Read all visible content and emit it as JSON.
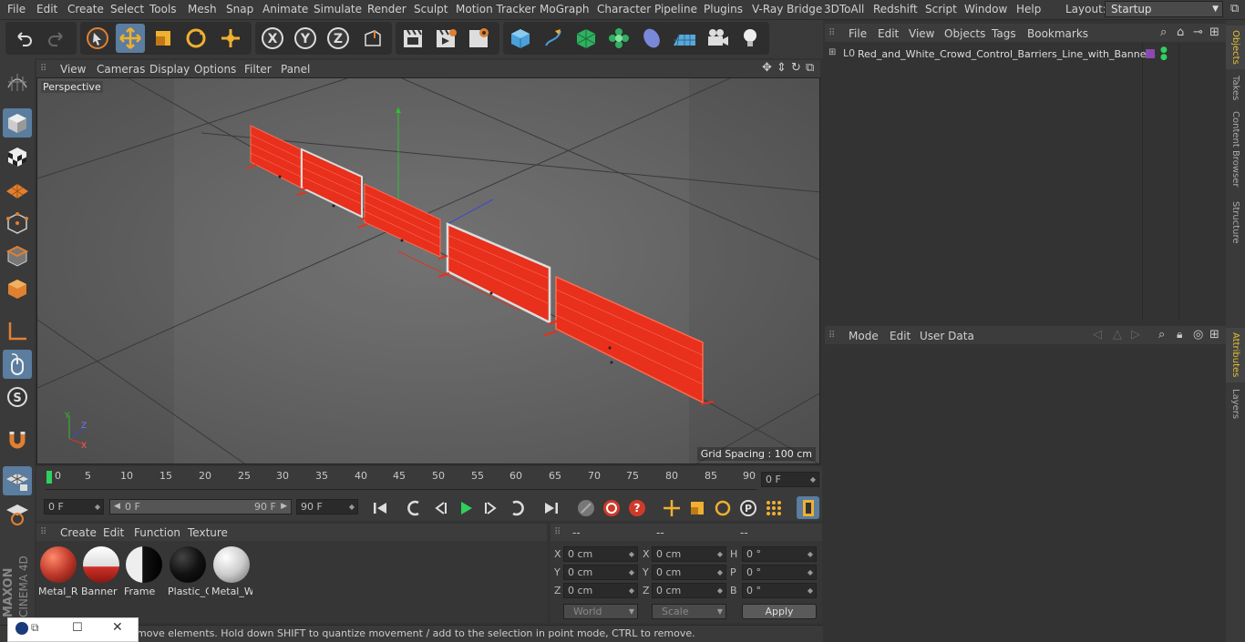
{
  "menubar": {
    "items": [
      "File",
      "Edit",
      "Create",
      "Select",
      "Tools",
      "Mesh",
      "Snap",
      "Animate",
      "Simulate",
      "Render",
      "Sculpt",
      "Motion Tracker",
      "MoGraph",
      "Character",
      "Pipeline",
      "Plugins",
      "V-Ray Bridge",
      "3DToAll",
      "Redshift",
      "Script",
      "Window",
      "Help"
    ],
    "layout_label": "Layout:",
    "layout_value": "Startup"
  },
  "viewport": {
    "menu": [
      "View",
      "Cameras",
      "Display",
      "Options",
      "Filter",
      "Panel"
    ],
    "label": "Perspective",
    "grid_spacing": "Grid Spacing : 100 cm"
  },
  "timeline": {
    "ticks": [
      "0",
      "5",
      "10",
      "15",
      "20",
      "25",
      "30",
      "35",
      "40",
      "45",
      "50",
      "55",
      "60",
      "65",
      "70",
      "75",
      "80",
      "85",
      "90"
    ],
    "current_frame": "0 F"
  },
  "transport": {
    "start": "0 F",
    "range_start": "0 F",
    "range_end": "90 F",
    "end": "90 F"
  },
  "materials": {
    "menu": [
      "Create",
      "Edit",
      "Function",
      "Texture"
    ],
    "items": [
      {
        "name": "Metal_R",
        "color": "#c0392b"
      },
      {
        "name": "Banner",
        "color": "#e8e8e8"
      },
      {
        "name": "Frame",
        "color": "#222222"
      },
      {
        "name": "Plastic_C",
        "color": "#111111"
      },
      {
        "name": "Metal_W",
        "color": "#cfcfcf"
      }
    ]
  },
  "coords": {
    "headers": [
      "--",
      "--",
      "--"
    ],
    "rows": [
      {
        "a": "X",
        "av": "0 cm",
        "b": "X",
        "bv": "0 cm",
        "c": "H",
        "cv": "0 °"
      },
      {
        "a": "Y",
        "av": "0 cm",
        "b": "Y",
        "bv": "0 cm",
        "c": "P",
        "cv": "0 °"
      },
      {
        "a": "Z",
        "av": "0 cm",
        "b": "Z",
        "bv": "0 cm",
        "c": "B",
        "cv": "0 °"
      }
    ],
    "world": "World",
    "scale": "Scale",
    "apply": "Apply"
  },
  "status": "move elements. Hold down SHIFT to quantize movement / add to the selection in point mode, CTRL to remove.",
  "objects": {
    "menu": [
      "File",
      "Edit",
      "View",
      "Objects",
      "Tags",
      "Bookmarks"
    ],
    "items": [
      {
        "name": "Red_and_White_Crowd_Control_Barriers_Line_with_Banners"
      }
    ]
  },
  "attributes": {
    "menu": [
      "Mode",
      "Edit",
      "User Data"
    ]
  },
  "right_tabs": [
    "Objects",
    "Takes",
    "Content Browser",
    "Structure",
    "Attributes",
    "Layers"
  ],
  "logo": {
    "line1": "MAXON",
    "line2": "CINEMA 4D"
  },
  "colors": {
    "accent": "#5a7da0",
    "barrier": "#e8301c"
  }
}
